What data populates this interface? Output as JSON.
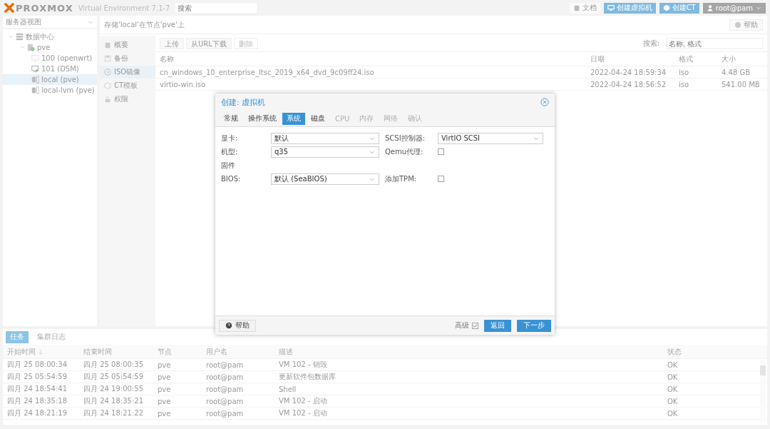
{
  "header": {
    "logo": "PROXMOX",
    "version": "Virtual Environment 7.1-7",
    "search": {
      "placeholder": "搜索"
    },
    "buttons": [
      {
        "label": "文档",
        "kind": "docs"
      },
      {
        "label": "创建虚拟机",
        "kind": "vm"
      },
      {
        "label": "创建CT",
        "kind": "ct"
      },
      {
        "label": "root@pam",
        "kind": "user"
      }
    ]
  },
  "sidebar": {
    "view": "服务器视图",
    "tree": [
      {
        "label": "数据中心",
        "kind": "datacenter",
        "selected": false,
        "expanded": true,
        "children": [
          {
            "label": "pve",
            "kind": "node",
            "selected": false,
            "expanded": true,
            "children": [
              {
                "label": "100 (openwrt)",
                "kind": "vm",
                "selected": false
              },
              {
                "label": "101 (DSM)",
                "kind": "vm-running",
                "selected": false
              },
              {
                "label": "local (pve)",
                "kind": "storage",
                "selected": true
              },
              {
                "label": "local-lvm (pve)",
                "kind": "storage",
                "selected": false
              }
            ]
          }
        ]
      }
    ]
  },
  "content": {
    "title": "存储'local'在节点'pve'上",
    "help": "帮助",
    "nav": [
      {
        "label": "概要",
        "kind": "summary",
        "selected": false
      },
      {
        "label": "备份",
        "kind": "backup",
        "selected": false
      },
      {
        "label": "ISO镜像",
        "kind": "iso",
        "selected": true
      },
      {
        "label": "CT模板",
        "kind": "ct",
        "selected": false
      },
      {
        "label": "权限",
        "kind": "lock",
        "selected": false
      }
    ],
    "toolbar": [
      {
        "label": "上传",
        "disabled": false
      },
      {
        "label": "从URL下载",
        "disabled": false
      },
      {
        "label": "删除",
        "disabled": true
      }
    ],
    "search": {
      "label": "搜索:",
      "placeholder": "名称, 格式"
    },
    "table": {
      "columns": [
        "名称",
        "日期",
        "格式",
        "大小"
      ],
      "rows": [
        [
          "cn_windows_10_enterprise_ltsc_2019_x64_dvd_9c09ff24.iso",
          "2022-04-24 18:59:34",
          "iso",
          "4.48 GB"
        ],
        [
          "virtio-win.iso",
          "2022-04-24 18:56:52",
          "iso",
          "541.00 MB"
        ]
      ]
    }
  },
  "log": {
    "tabs": [
      {
        "label": "任务",
        "selected": true
      },
      {
        "label": "集群日志",
        "selected": false
      }
    ],
    "columns": [
      "开始时间",
      "结束时间",
      "节点",
      "用户名",
      "描述",
      "状态"
    ],
    "rows": [
      [
        "四月 25 08:00:34",
        "四月 25 08:00:35",
        "pve",
        "root@pam",
        "VM 102 - 销毁",
        "OK"
      ],
      [
        "四月 25 05:54:59",
        "四月 25 05:54:59",
        "pve",
        "root@pam",
        "更新软件包数据库",
        "OK"
      ],
      [
        "四月 24 18:54:41",
        "四月 24 19:00:55",
        "pve",
        "root@pam",
        "Shell",
        "OK"
      ],
      [
        "四月 24 18:35:18",
        "四月 24 18:35:21",
        "pve",
        "root@pam",
        "VM 102 - 启动",
        "OK"
      ],
      [
        "四月 24 18:21:19",
        "四月 24 18:21:22",
        "pve",
        "root@pam",
        "VM 102 - 启动",
        "OK"
      ]
    ]
  },
  "dialog": {
    "title": "创建: 虚拟机",
    "tabs": [
      {
        "label": "常规",
        "selected": false,
        "disabled": false
      },
      {
        "label": "操作系统",
        "selected": false,
        "disabled": false
      },
      {
        "label": "系统",
        "selected": true,
        "disabled": false
      },
      {
        "label": "磁盘",
        "selected": false,
        "disabled": false
      },
      {
        "label": "CPU",
        "selected": false,
        "disabled": true
      },
      {
        "label": "内存",
        "selected": false,
        "disabled": true
      },
      {
        "label": "网络",
        "selected": false,
        "disabled": true
      },
      {
        "label": "确认",
        "selected": false,
        "disabled": true
      }
    ],
    "rows": [
      [
        {
          "kind": "select",
          "label": "显卡:",
          "value": "默认"
        },
        {
          "kind": "select",
          "label": "SCSI控制器:",
          "value": "VirtIO SCSI"
        }
      ],
      [
        {
          "kind": "select",
          "label": "机型:",
          "value": "q35"
        },
        {
          "kind": "checkbox",
          "label": "Qemu代理:",
          "checked": false
        }
      ],
      [
        {
          "kind": "heading",
          "label": "固件"
        }
      ],
      [
        {
          "kind": "select",
          "label": "BIOS:",
          "value": "默认 (SeaBIOS)"
        },
        {
          "kind": "checkbox",
          "label": "添加TPM:",
          "checked": false
        }
      ]
    ],
    "help": "帮助",
    "advanced": {
      "label": "高级",
      "checked": true
    },
    "buttons": [
      "返回",
      "下一步"
    ]
  }
}
